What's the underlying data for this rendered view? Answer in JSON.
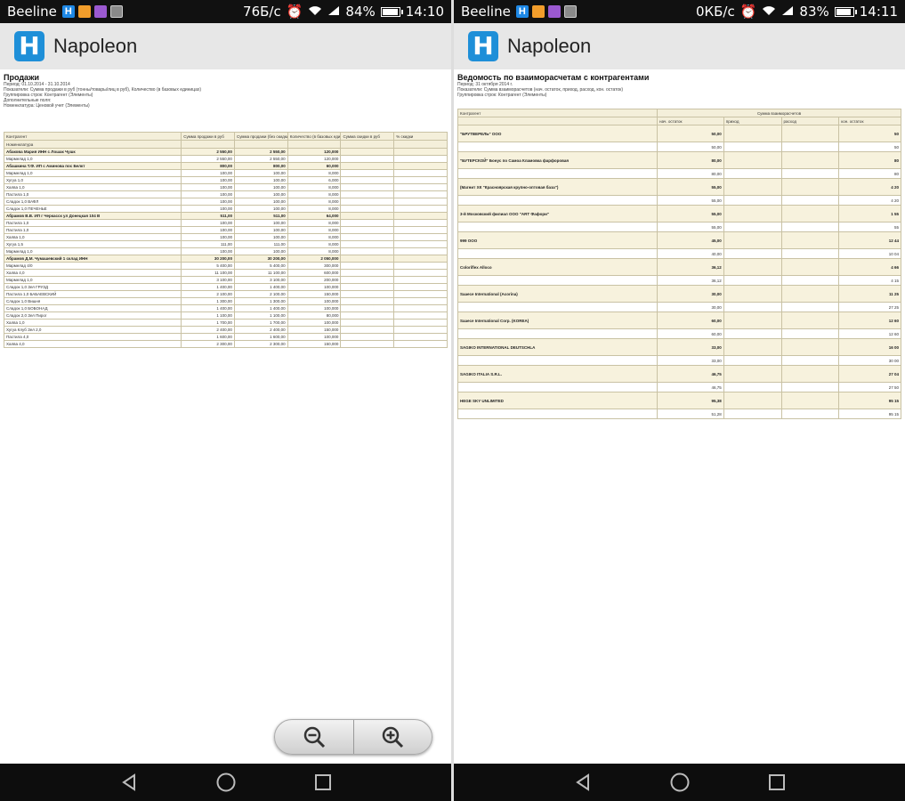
{
  "left": {
    "status": {
      "carrier": "Beeline",
      "speed": "76Б/с",
      "signal": "84%",
      "battery_percent": 84,
      "time": "14:10"
    },
    "app": {
      "name": "Napoleon"
    },
    "report": {
      "title": "Продажи",
      "param_lines": [
        "Период: 01.10.2014 - 31.10.2014",
        "Показатели: Сумма продажи в руб (тонны/товары/лиц в руб), Количество (в базовых единицах)",
        "Группировка строк: Контрагент (Элементы)",
        "Дополнительные поля:",
        "Номенклатура: Ценовой учет (Элементы)"
      ],
      "columns": [
        "Контрагент",
        "Сумма продажи в руб",
        "Сумма продажи (без скидки в руб)",
        "Количество (в базовых единицах)",
        "Сумма скидки в руб",
        "% скидки"
      ],
      "subheader": "Номенклатура",
      "rows": [
        {
          "g": true,
          "c": [
            "Абакова Мария ИНН с Лошак Чушк",
            "2 550,00",
            "2 550,00",
            "120,000",
            "",
            ""
          ]
        },
        {
          "c": [
            "Мармелад 1,0",
            "2 550,00",
            "2 550,00",
            "120,000",
            "",
            ""
          ]
        },
        {
          "g": true,
          "c": [
            "Абашкина Т.Ф. ИП с Аминова пос Белкт",
            "800,00",
            "800,00",
            "60,000",
            "",
            ""
          ]
        },
        {
          "c": [
            "Мармелад 1,0",
            "100,00",
            "100,00",
            "8,000",
            "",
            ""
          ]
        },
        {
          "c": [
            "Хугуа 1,0",
            "100,00",
            "100,00",
            "6,000",
            "",
            ""
          ]
        },
        {
          "c": [
            "Халва 1,0",
            "100,00",
            "100,00",
            "8,000",
            "",
            ""
          ]
        },
        {
          "c": [
            "Пастила 1,0",
            "100,00",
            "100,00",
            "8,000",
            "",
            ""
          ]
        },
        {
          "c": [
            "Сладок 1,0 ВАФЛ",
            "100,00",
            "100,00",
            "8,000",
            "",
            ""
          ]
        },
        {
          "c": [
            "Сладок 1,0 ПЕЧЕНЬЕ",
            "100,00",
            "100,00",
            "8,000",
            "",
            ""
          ]
        },
        {
          "g": true,
          "c": [
            "Абрамов В.В. ИП г Черкасск ул Донецкая 104 В",
            "511,00",
            "511,00",
            "64,000",
            "",
            ""
          ]
        },
        {
          "c": [
            "Пастила 1,0",
            "100,00",
            "100,00",
            "8,000",
            "",
            ""
          ]
        },
        {
          "c": [
            "Пастила 1,0",
            "100,00",
            "100,00",
            "8,000",
            "",
            ""
          ]
        },
        {
          "c": [
            "Халва 1,0",
            "100,00",
            "100,00",
            "8,000",
            "",
            ""
          ]
        },
        {
          "c": [
            "Хугуа 1,5",
            "111,00",
            "111,00",
            "8,000",
            "",
            ""
          ]
        },
        {
          "c": [
            "Мармелад 1,0",
            "100,00",
            "100,00",
            "8,000",
            "",
            ""
          ]
        },
        {
          "g": true,
          "c": [
            "Абрамов Д.М. Чумашевский 1 склад ИНН",
            "30 200,00",
            "30 200,00",
            "2 050,000",
            "",
            ""
          ]
        },
        {
          "c": [
            "Мармелад 4/0",
            "5 400,00",
            "5 400,00",
            "300,000",
            "",
            ""
          ]
        },
        {
          "c": [
            "Халва 4,0",
            "11 100,00",
            "11 100,00",
            "600,000",
            "",
            ""
          ]
        },
        {
          "c": [
            "Мармелад 1,0",
            "3 100,00",
            "3 100,00",
            "200,000",
            "",
            ""
          ]
        },
        {
          "c": [
            "Сладок 1,0 Зел ГРУЗД",
            "1 400,00",
            "1 400,00",
            "100,000",
            "",
            ""
          ]
        },
        {
          "c": [
            "Пастила 1,0 БАБАЕВСКИЙ",
            "2 100,00",
            "2 100,00",
            "150,000",
            "",
            ""
          ]
        },
        {
          "c": [
            "Сладок 1,0 Вишня",
            "1 300,00",
            "1 300,00",
            "100,000",
            "",
            ""
          ]
        },
        {
          "c": [
            "Сладок 1,0 БОБОНАД",
            "1 400,00",
            "1 400,00",
            "100,000",
            "",
            ""
          ]
        },
        {
          "c": [
            "Сладок 2,0 Зел Пирог",
            "1 100,00",
            "1 100,00",
            "80,000",
            "",
            ""
          ]
        },
        {
          "c": [
            "Халва 1,0",
            "1 700,00",
            "1 700,00",
            "100,000",
            "",
            ""
          ]
        },
        {
          "c": [
            "Хугуа Клуб Зел 2,0",
            "2 400,00",
            "2 400,00",
            "150,000",
            "",
            ""
          ]
        },
        {
          "c": [
            "Пастила 4,0",
            "1 600,00",
            "1 600,00",
            "100,000",
            "",
            ""
          ]
        },
        {
          "c": [
            "Халва 4,0",
            "2 300,00",
            "2 300,00",
            "150,000",
            "",
            ""
          ]
        }
      ]
    },
    "zoom": {
      "out_label": "zoom out",
      "in_label": "zoom in"
    }
  },
  "right": {
    "status": {
      "carrier": "Beeline",
      "speed": "0КБ/с",
      "signal": "83%",
      "battery_percent": 83,
      "time": "14:11"
    },
    "app": {
      "name": "Napoleon"
    },
    "report": {
      "title": "Ведомость по взаиморасчетам с контрагентами",
      "param_lines": [
        "Период: 31 октября 2014 г.",
        "Показатели: Сумма взаиморасчетов (нач. остаток, приход, расход, кон. остаток)",
        "Группировка строк: Контрагент (Элементы)"
      ],
      "columns": [
        "Контрагент",
        "нач. остаток",
        "приход",
        "расход",
        "кон. остаток"
      ],
      "col_group": "Сумма взаиморасчетов",
      "rows": [
        {
          "g": true,
          "c": [
            "\"БРУТВЕРЕЛЬ\" ООО",
            "50,00",
            "",
            "",
            "50"
          ]
        },
        {
          "c": [
            "",
            "50,00",
            "",
            "",
            "50"
          ]
        },
        {
          "g": true,
          "c": [
            "\"БУТЕРСКОЙ\" Бонус по Самоа Кламовка фарфоровая",
            "80,00",
            "",
            "",
            "80"
          ]
        },
        {
          "c": [
            "",
            "80,00",
            "",
            "",
            "80"
          ]
        },
        {
          "g": true,
          "c": [
            "(Магнит ХК \"Красноярская крупно-оптовая база\")",
            "55,00",
            "",
            "",
            "4 20"
          ]
        },
        {
          "c": [
            "",
            "55,00",
            "",
            "",
            "4 20"
          ]
        },
        {
          "g": true,
          "c": [
            "3-й Московский филиал ООО \"ART Фафори\"",
            "55,00",
            "",
            "",
            "1 55"
          ]
        },
        {
          "c": [
            "",
            "55,00",
            "",
            "",
            "55"
          ]
        },
        {
          "g": true,
          "c": [
            "999 ООО",
            "45,00",
            "",
            "",
            "12 44"
          ]
        },
        {
          "c": [
            "",
            "40,00",
            "",
            "",
            "10 04"
          ]
        },
        {
          "g": true,
          "c": [
            "Coloriflex Alloco",
            "36,12",
            "",
            "",
            "4 66"
          ]
        },
        {
          "c": [
            "",
            "36,12",
            "",
            "",
            "4 15"
          ]
        },
        {
          "g": true,
          "c": [
            "Saaece International (Acorina)",
            "30,00",
            "",
            "",
            "11 25"
          ]
        },
        {
          "c": [
            "",
            "30,00",
            "",
            "",
            "27 25"
          ]
        },
        {
          "g": true,
          "c": [
            "Saaece International Corp. (KOREA)",
            "60,00",
            "",
            "",
            "12 60"
          ]
        },
        {
          "c": [
            "",
            "60,00",
            "",
            "",
            "12 60"
          ]
        },
        {
          "g": true,
          "c": [
            "SAGIKO INTERNATIONAL DEUTSCHLA",
            "33,00",
            "",
            "",
            "16 00"
          ]
        },
        {
          "c": [
            "",
            "33,00",
            "",
            "",
            "30 00"
          ]
        },
        {
          "g": true,
          "c": [
            "SAGIKO ITALIA S.R.L.",
            "46,75",
            "",
            "",
            "27 04"
          ]
        },
        {
          "c": [
            "",
            "46,75",
            "",
            "",
            "27 50"
          ]
        },
        {
          "g": true,
          "c": [
            "HEGE SKY UNLIMITED",
            "95,38",
            "",
            "",
            "95 15"
          ]
        },
        {
          "c": [
            "",
            "51,28",
            "",
            "",
            "95 15"
          ]
        }
      ]
    }
  }
}
